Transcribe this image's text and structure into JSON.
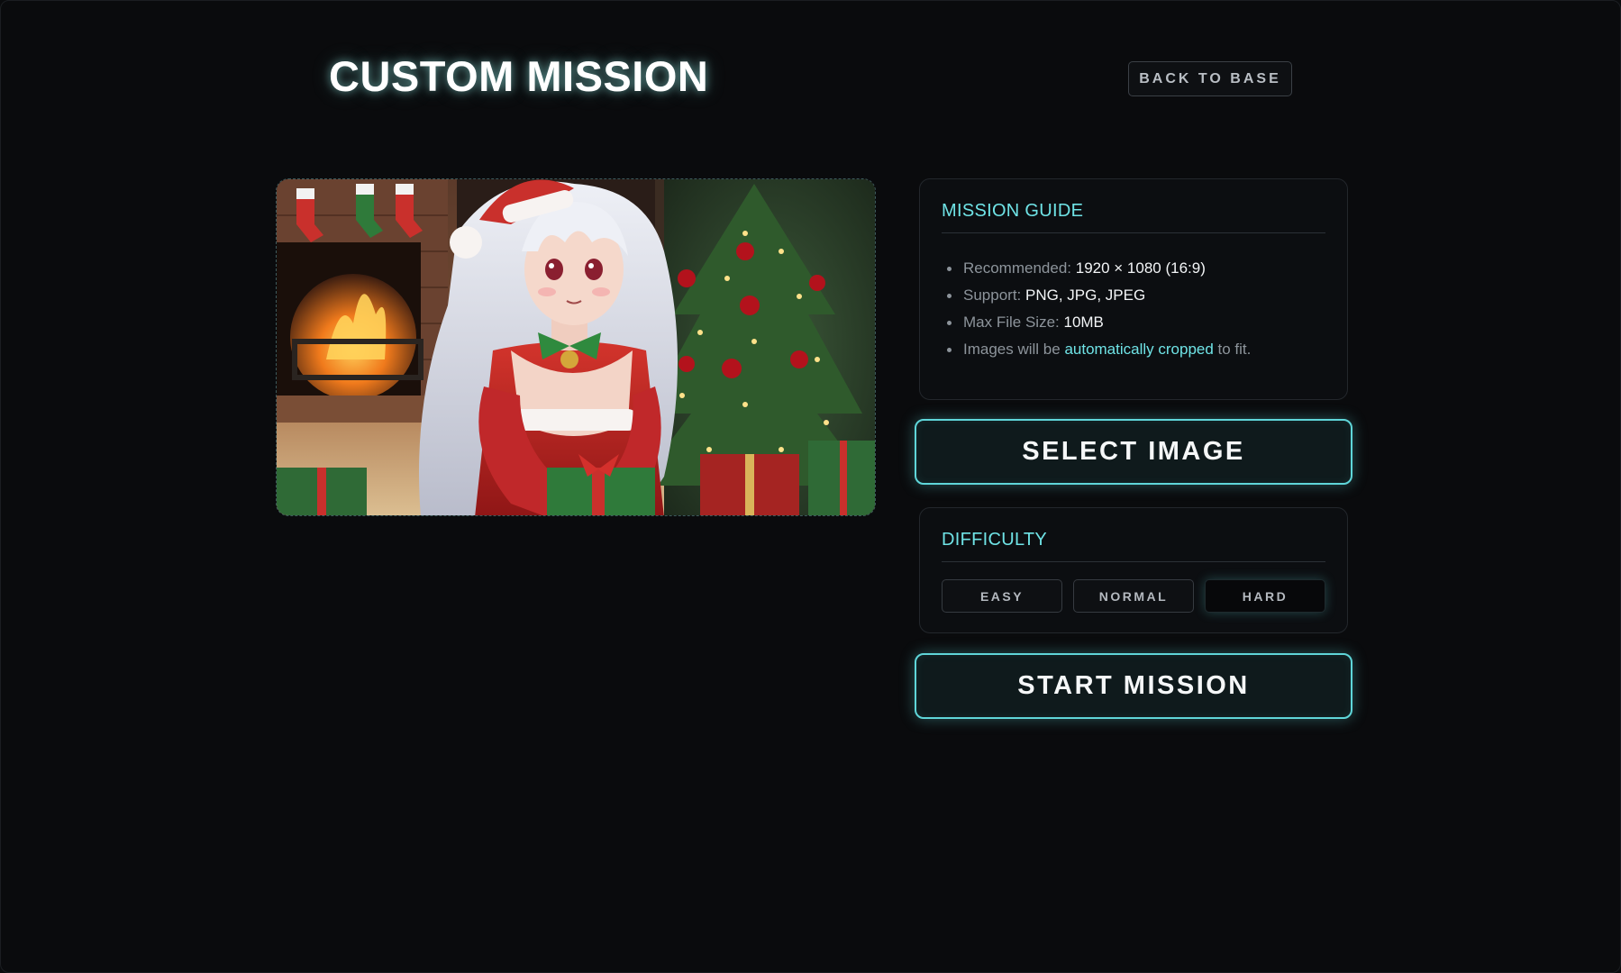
{
  "header": {
    "title": "CUSTOM MISSION",
    "back_label": "BACK TO BASE"
  },
  "preview": {
    "alt": "Uploaded mission image preview"
  },
  "guide": {
    "heading": "MISSION GUIDE",
    "items": [
      {
        "label": "Recommended: ",
        "value": "1920 × 1080 (16:9)"
      },
      {
        "label": "Support: ",
        "value": "PNG, JPG, JPEG"
      },
      {
        "label": "Max File Size: ",
        "value": "10MB"
      }
    ],
    "note": {
      "before": "Images will be ",
      "highlight": "automatically cropped",
      "after": " to fit."
    }
  },
  "select_button": "SELECT IMAGE",
  "difficulty": {
    "heading": "DIFFICULTY",
    "options": [
      "EASY",
      "NORMAL",
      "HARD"
    ],
    "selected": "HARD"
  },
  "start_button": "START MISSION",
  "colors": {
    "accent": "#6fe3e6",
    "background": "#0a0b0d"
  }
}
